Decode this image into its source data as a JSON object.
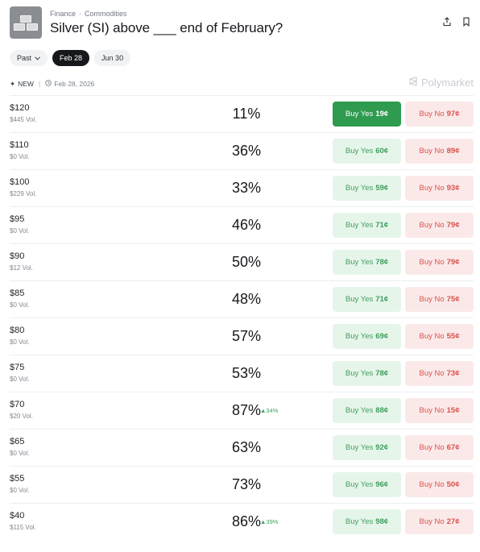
{
  "breadcrumb": {
    "category": "Finance",
    "subcategory": "Commodities"
  },
  "title": "Silver (SI) above ___ end of February?",
  "tabs": [
    {
      "label": "Past",
      "dropdown": true,
      "active": false
    },
    {
      "label": "Feb 28",
      "active": true
    },
    {
      "label": "Jun 30",
      "active": false
    }
  ],
  "meta": {
    "new_label": "NEW",
    "date": "Feb 28, 2026",
    "brand": "Polymarket"
  },
  "colors": {
    "yes_accent": "#2e9b4f",
    "yes_light": "#e6f5ea",
    "no_light": "#fbe9e9",
    "no_text": "#d9534f"
  },
  "rows": [
    {
      "strike": "$120",
      "volume": "$445 Vol.",
      "chance": "11%",
      "delta": "",
      "yes_label": "Buy Yes",
      "yes_price": "19¢",
      "no_label": "Buy No",
      "no_price": "97¢",
      "yes_active": true
    },
    {
      "strike": "$110",
      "volume": "$0 Vol.",
      "chance": "36%",
      "delta": "",
      "yes_label": "Buy Yes",
      "yes_price": "60¢",
      "no_label": "Buy No",
      "no_price": "89¢"
    },
    {
      "strike": "$100",
      "volume": "$229 Vol.",
      "chance": "33%",
      "delta": "",
      "yes_label": "Buy Yes",
      "yes_price": "59¢",
      "no_label": "Buy No",
      "no_price": "93¢"
    },
    {
      "strike": "$95",
      "volume": "$0 Vol.",
      "chance": "46%",
      "delta": "",
      "yes_label": "Buy Yes",
      "yes_price": "71¢",
      "no_label": "Buy No",
      "no_price": "79¢"
    },
    {
      "strike": "$90",
      "volume": "$12 Vol.",
      "chance": "50%",
      "delta": "",
      "yes_label": "Buy Yes",
      "yes_price": "78¢",
      "no_label": "Buy No",
      "no_price": "79¢"
    },
    {
      "strike": "$85",
      "volume": "$0 Vol.",
      "chance": "48%",
      "delta": "",
      "yes_label": "Buy Yes",
      "yes_price": "71¢",
      "no_label": "Buy No",
      "no_price": "75¢"
    },
    {
      "strike": "$80",
      "volume": "$0 Vol.",
      "chance": "57%",
      "delta": "",
      "yes_label": "Buy Yes",
      "yes_price": "69¢",
      "no_label": "Buy No",
      "no_price": "55¢"
    },
    {
      "strike": "$75",
      "volume": "$0 Vol.",
      "chance": "53%",
      "delta": "",
      "yes_label": "Buy Yes",
      "yes_price": "78¢",
      "no_label": "Buy No",
      "no_price": "73¢"
    },
    {
      "strike": "$70",
      "volume": "$20 Vol.",
      "chance": "87%",
      "delta": "▲34%",
      "yes_label": "Buy Yes",
      "yes_price": "88¢",
      "no_label": "Buy No",
      "no_price": "15¢"
    },
    {
      "strike": "$65",
      "volume": "$0 Vol.",
      "chance": "63%",
      "delta": "",
      "yes_label": "Buy Yes",
      "yes_price": "92¢",
      "no_label": "Buy No",
      "no_price": "67¢"
    },
    {
      "strike": "$55",
      "volume": "$0 Vol.",
      "chance": "73%",
      "delta": "",
      "yes_label": "Buy Yes",
      "yes_price": "96¢",
      "no_label": "Buy No",
      "no_price": "50¢"
    },
    {
      "strike": "$40",
      "volume": "$115 Vol.",
      "chance": "86%",
      "delta": "▲39%",
      "yes_label": "Buy Yes",
      "yes_price": "98¢",
      "no_label": "Buy No",
      "no_price": "27¢"
    }
  ]
}
